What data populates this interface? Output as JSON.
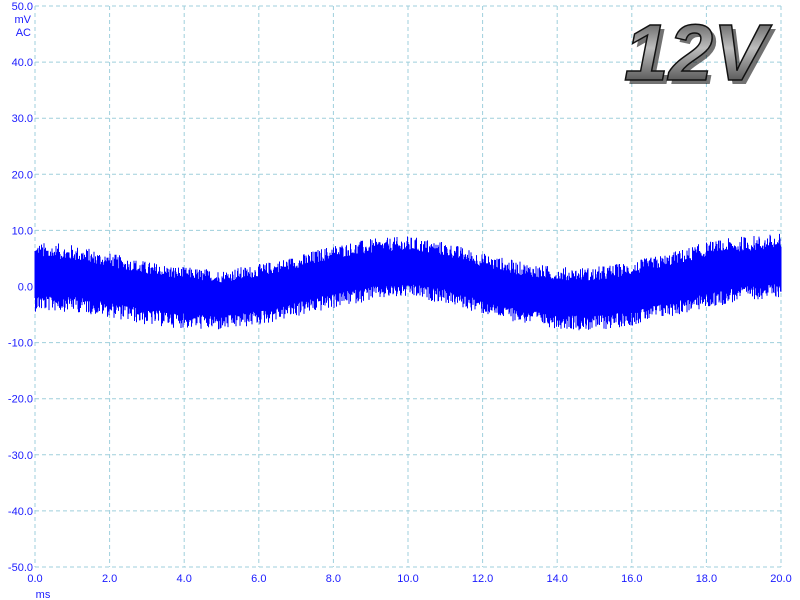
{
  "chart_data": {
    "type": "line",
    "title": "",
    "overlay_label": "12V",
    "y_unit": "mV",
    "coupling": "AC",
    "x_unit": "ms",
    "xlim": [
      0,
      20
    ],
    "ylim": [
      -50,
      50
    ],
    "x_ticks": [
      "0.0",
      "2.0",
      "4.0",
      "6.0",
      "8.0",
      "10.0",
      "12.0",
      "14.0",
      "16.0",
      "18.0",
      "20.0"
    ],
    "y_ticks": [
      "50.0",
      "40.0",
      "30.0",
      "20.0",
      "10.0",
      "0.0",
      "-10.0",
      "-20.0",
      "-30.0",
      "-40.0",
      "-50.0"
    ],
    "grid": true,
    "series": [
      {
        "color": "#0000ff",
        "description_envelope": "noisy band approx -8..+9 mV riding on slow ripple",
        "x": [
          0,
          1,
          2,
          3,
          4,
          5,
          6,
          7,
          8,
          9,
          10,
          11,
          12,
          13,
          14,
          15,
          16,
          17,
          18,
          19,
          20
        ],
        "center": [
          1.5,
          1.5,
          0.5,
          -0.5,
          -1.5,
          -2.0,
          -1.0,
          0.5,
          2.0,
          3.0,
          3.5,
          2.5,
          0.5,
          -1.0,
          -2.0,
          -2.0,
          -1.0,
          0.5,
          2.0,
          3.0,
          3.5
        ],
        "upper": [
          8.0,
          7.5,
          6.0,
          4.5,
          3.5,
          3.0,
          4.0,
          5.5,
          7.5,
          8.5,
          9.0,
          8.0,
          6.0,
          4.5,
          3.5,
          3.5,
          4.5,
          6.0,
          8.0,
          9.0,
          9.5
        ],
        "lower": [
          -4.5,
          -4.5,
          -5.5,
          -7.0,
          -7.5,
          -8.0,
          -7.0,
          -5.5,
          -4.0,
          -2.5,
          -2.0,
          -3.0,
          -5.0,
          -6.5,
          -7.5,
          -8.0,
          -7.0,
          -5.5,
          -4.0,
          -2.5,
          -2.0
        ]
      }
    ]
  }
}
